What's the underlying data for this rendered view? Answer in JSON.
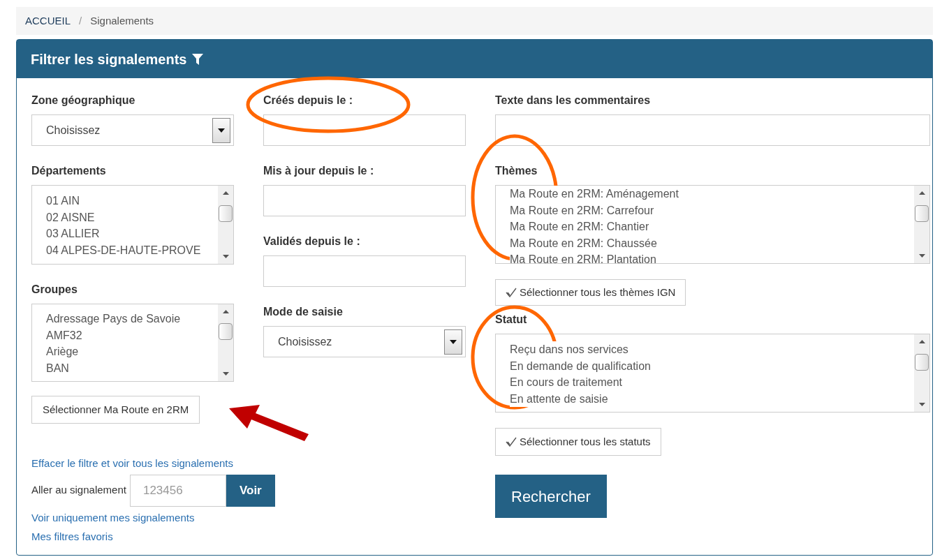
{
  "breadcrumb": [
    {
      "label": "ACCUEIL",
      "link": true
    },
    {
      "label": "Signalements",
      "link": false
    }
  ],
  "breadcrumb_separator": "/",
  "panel": {
    "title": "Filtrer les signalements"
  },
  "left": {
    "zone": {
      "label": "Zone géographique",
      "value": "Choisissez"
    },
    "departements": {
      "label": "Départements",
      "items": [
        "01 AIN",
        "02 AISNE",
        "03 ALLIER",
        "04 ALPES-DE-HAUTE-PROVE"
      ]
    },
    "groupes": {
      "label": "Groupes",
      "items": [
        "Adressage Pays de Savoie",
        "AMF32",
        "Ariège",
        "BAN"
      ]
    },
    "select_button": "Sélectionner Ma Route en 2RM",
    "clear_link": "Effacer le filtre et voir tous les signalements",
    "goto": {
      "label": "Aller au signalement",
      "placeholder": "123456",
      "button": "Voir"
    },
    "links": [
      "Voir uniquement mes signalements",
      "Mes filtres favoris"
    ]
  },
  "middle": {
    "dates": [
      {
        "label": "Créés depuis le :"
      },
      {
        "label": "Mis à jour depuis le :"
      },
      {
        "label": "Validés depuis le :"
      }
    ],
    "mode": {
      "label": "Mode de saisie",
      "value": "Choisissez"
    }
  },
  "right": {
    "comments": {
      "label": "Texte dans les commentaires"
    },
    "themes": {
      "label": "Thèmes",
      "items": [
        "Ma Route en 2RM: Aménagement",
        "Ma Route en 2RM: Carrefour",
        "Ma Route en 2RM: Chantier",
        "Ma Route en 2RM: Chaussée",
        "Ma Route en 2RM: Plantation"
      ],
      "button": "Sélectionner tous les thèmes IGN"
    },
    "statut": {
      "label": "Statut",
      "items": [
        "Reçu dans nos services",
        "En demande de qualification",
        "En cours de traitement",
        "En attente de saisie"
      ],
      "button": "Sélectionner tous les statuts"
    },
    "search_button": "Rechercher"
  }
}
